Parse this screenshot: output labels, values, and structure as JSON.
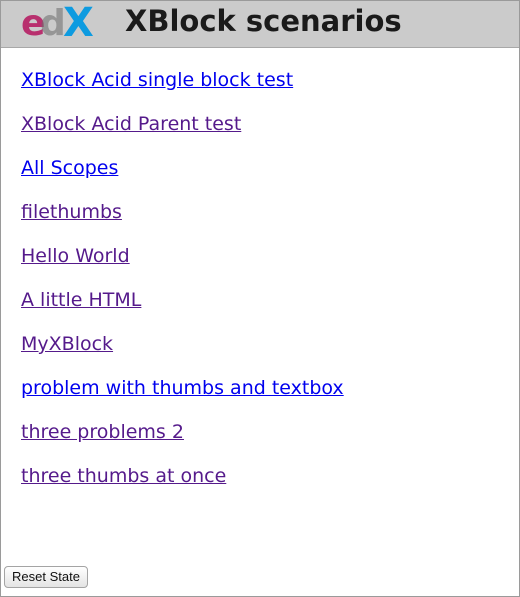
{
  "header": {
    "title": "XBlock scenarios",
    "logo_text": "edX",
    "logo_colors": {
      "e": "#b8306e",
      "d": "#6c6c6c",
      "x": "#0e9be0"
    }
  },
  "scenarios": [
    {
      "label": "XBlock Acid single block test",
      "visited": false
    },
    {
      "label": "XBlock Acid Parent test",
      "visited": true
    },
    {
      "label": "All Scopes",
      "visited": false
    },
    {
      "label": "filethumbs",
      "visited": true
    },
    {
      "label": "Hello World",
      "visited": true
    },
    {
      "label": "A little HTML",
      "visited": true
    },
    {
      "label": "MyXBlock",
      "visited": true
    },
    {
      "label": "problem with thumbs and textbox",
      "visited": false
    },
    {
      "label": "three problems 2",
      "visited": true
    },
    {
      "label": "three thumbs at once",
      "visited": true
    }
  ],
  "colors": {
    "link": "#0000ee",
    "link_visited": "#551a8b",
    "header_bg": "#cbcbcb"
  },
  "footer": {
    "reset_label": "Reset State"
  }
}
